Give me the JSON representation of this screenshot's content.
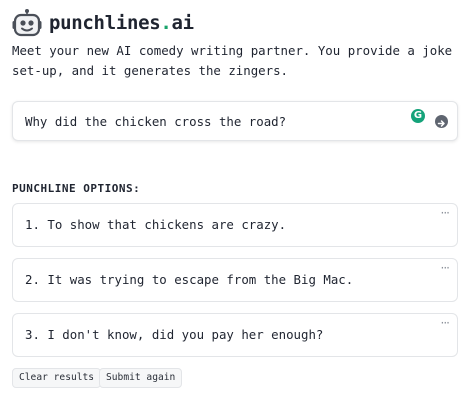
{
  "brand": {
    "name": "punchlines",
    "dot": ".",
    "suffix": "ai"
  },
  "intro": "Meet your new AI comedy writing partner. You provide a joke set-up, and it generates the zingers.",
  "prompt": {
    "value": "Why did the chicken cross the road?",
    "grammar_icon_glyph": "G"
  },
  "options_label": "PUNCHLINE OPTIONS:",
  "options": [
    {
      "text": "1. To show that chickens are crazy.",
      "menu": "···"
    },
    {
      "text": "2. It was trying to escape from the Big Mac.",
      "menu": "···"
    },
    {
      "text": "3. I don't know, did you pay her enough?",
      "menu": "···"
    }
  ],
  "buttons": {
    "clear": "Clear results",
    "submit_again": "Submit again"
  },
  "colors": {
    "accent": "#19a36b",
    "grammar_badge": "#15a37a",
    "submit_icon": "#5f6570",
    "border": "#e3e5e8",
    "text": "#1f2430"
  },
  "icons": {
    "logo": "robot-face-icon",
    "grammar": "grammar-check-icon",
    "submit": "arrow-right-circle-icon",
    "option_menu": "ellipsis-icon"
  }
}
